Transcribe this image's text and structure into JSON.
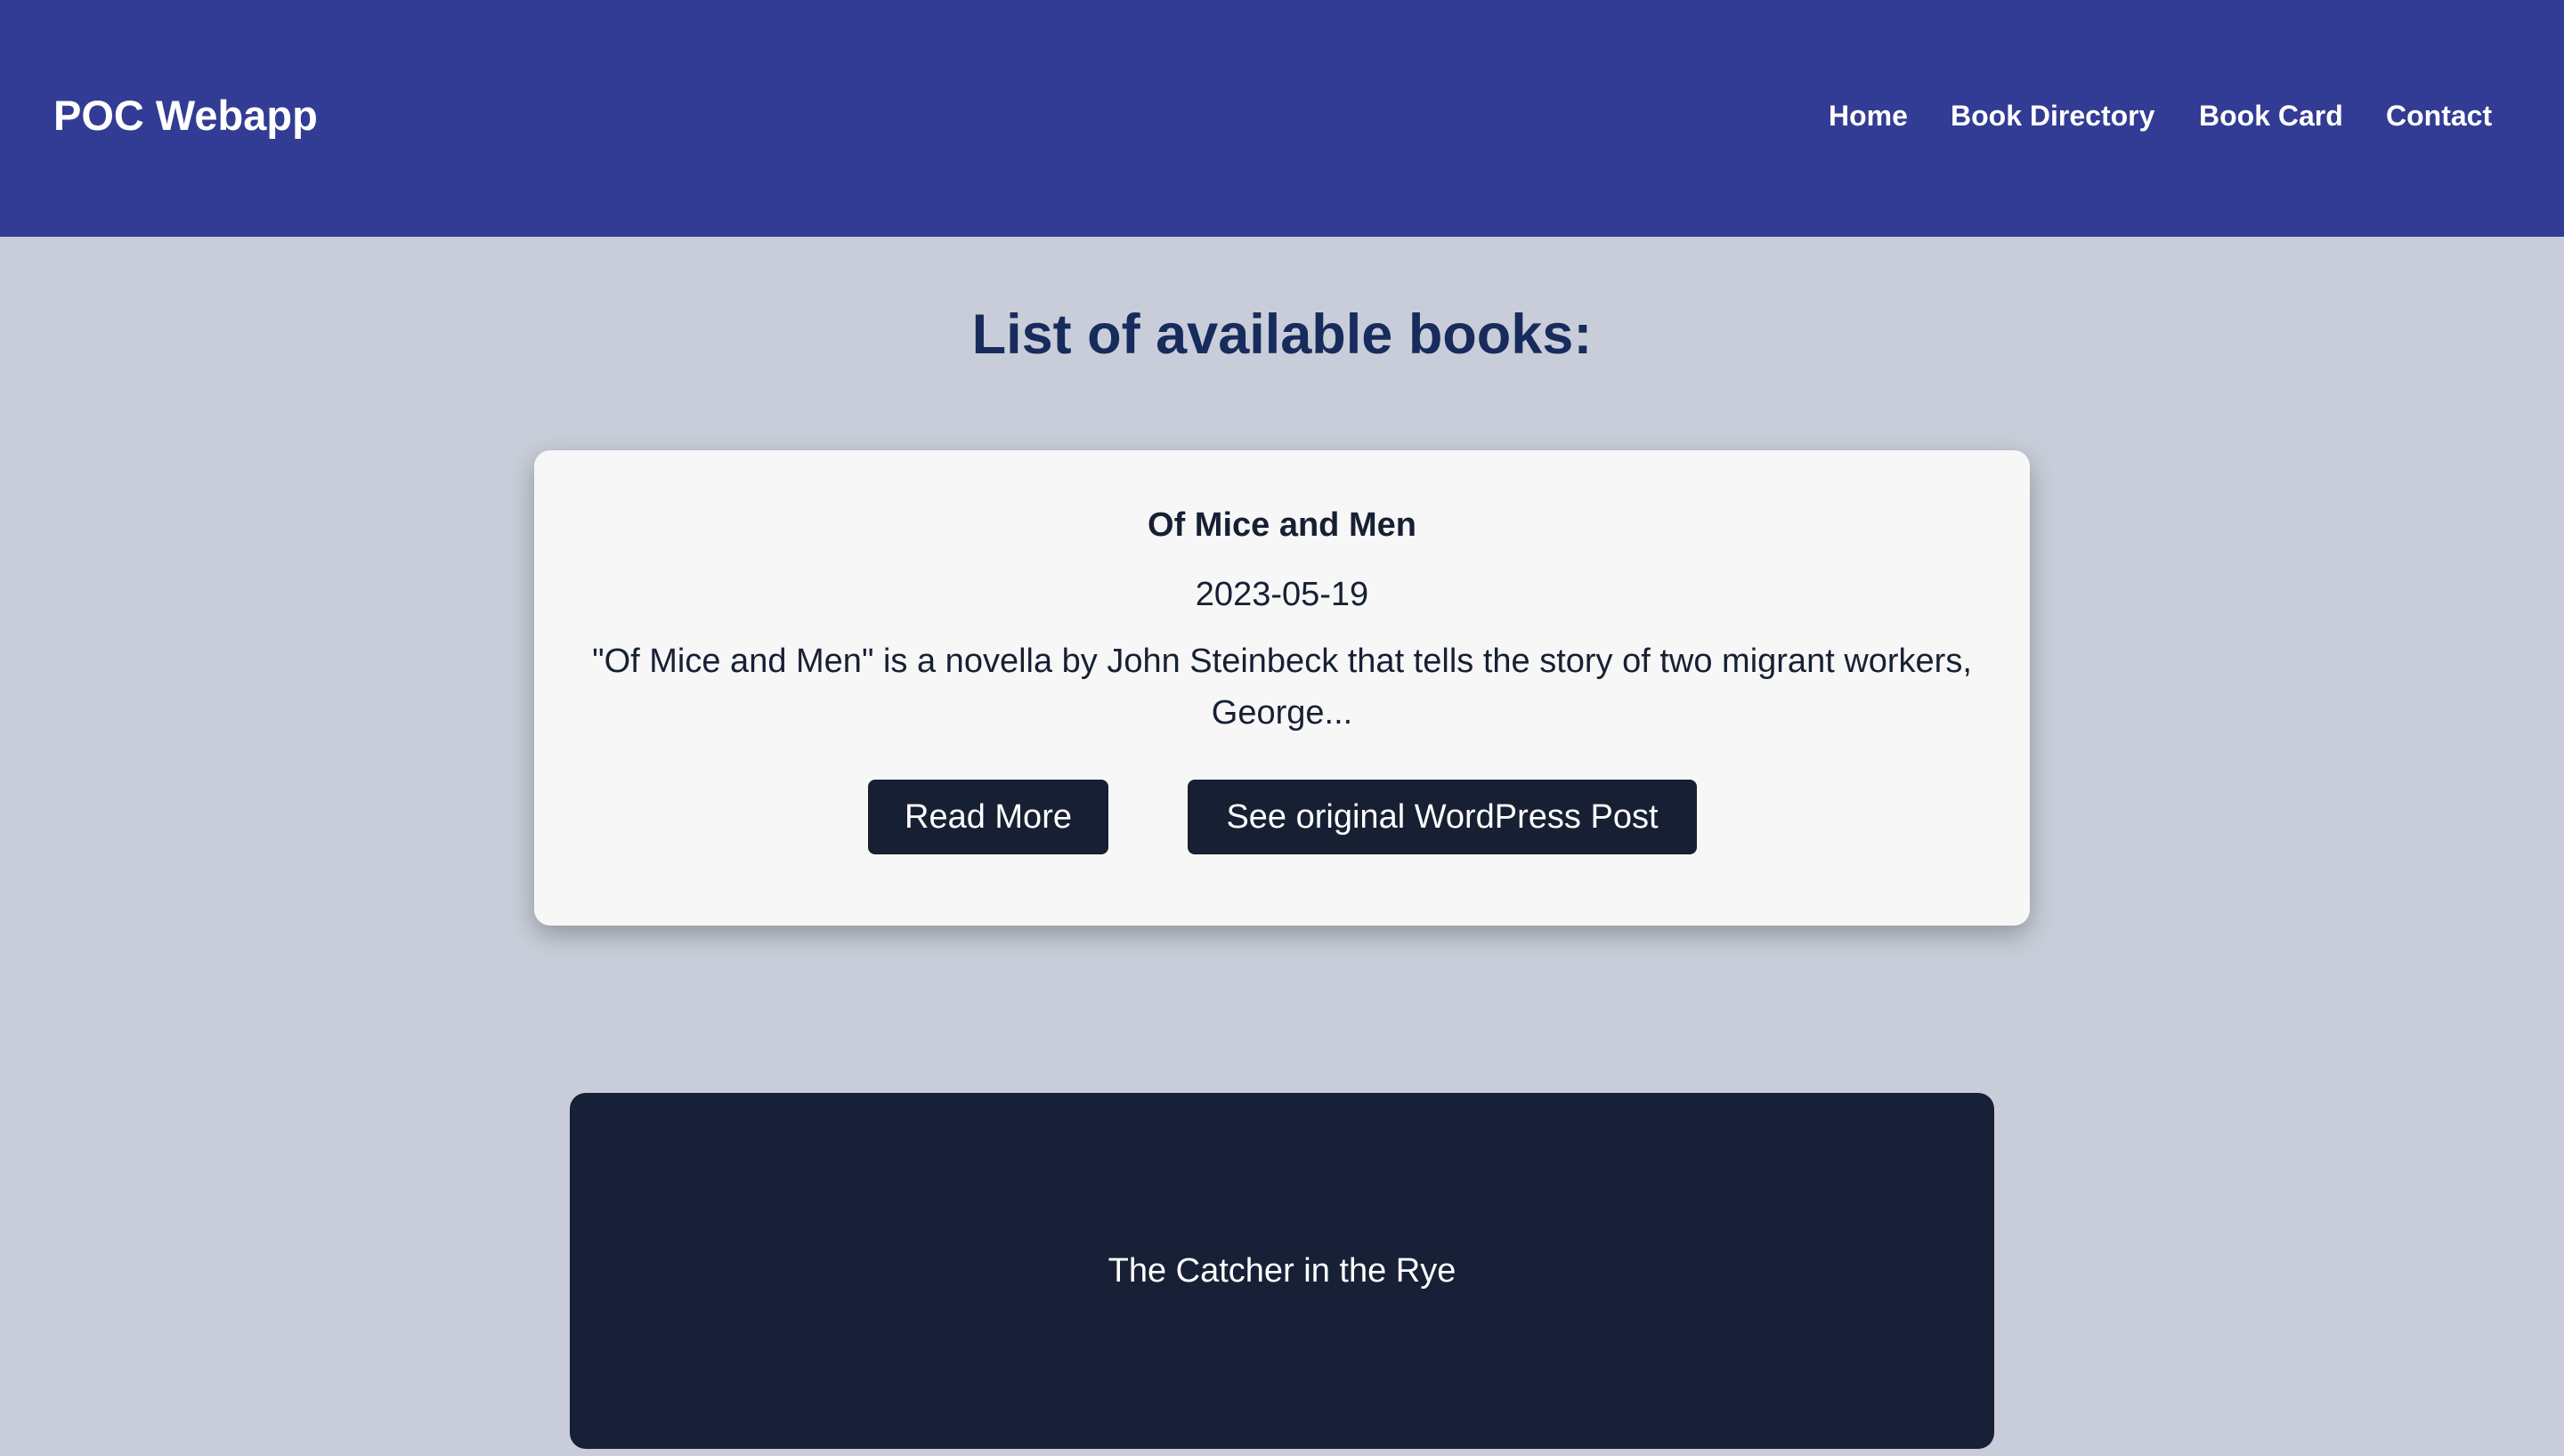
{
  "navbar": {
    "brand": "POC Webapp",
    "links": [
      "Home",
      "Book Directory",
      "Book Card",
      "Contact"
    ]
  },
  "main": {
    "heading": "List of available books:"
  },
  "book_card": {
    "title": "Of Mice and Men",
    "date": "2023-05-19",
    "excerpt": "\"Of Mice and Men\" is a novella by John Steinbeck that tells the story of two migrant workers, George...",
    "read_more_label": "Read More",
    "wordpress_label": "See original WordPress Post"
  },
  "second_card": {
    "title": "The Catcher in the Rye"
  },
  "colors": {
    "navbar": "#323c94",
    "background": "#c8cdd9",
    "heading": "#172b5c",
    "button": "#172033",
    "dark_card": "#172036"
  }
}
